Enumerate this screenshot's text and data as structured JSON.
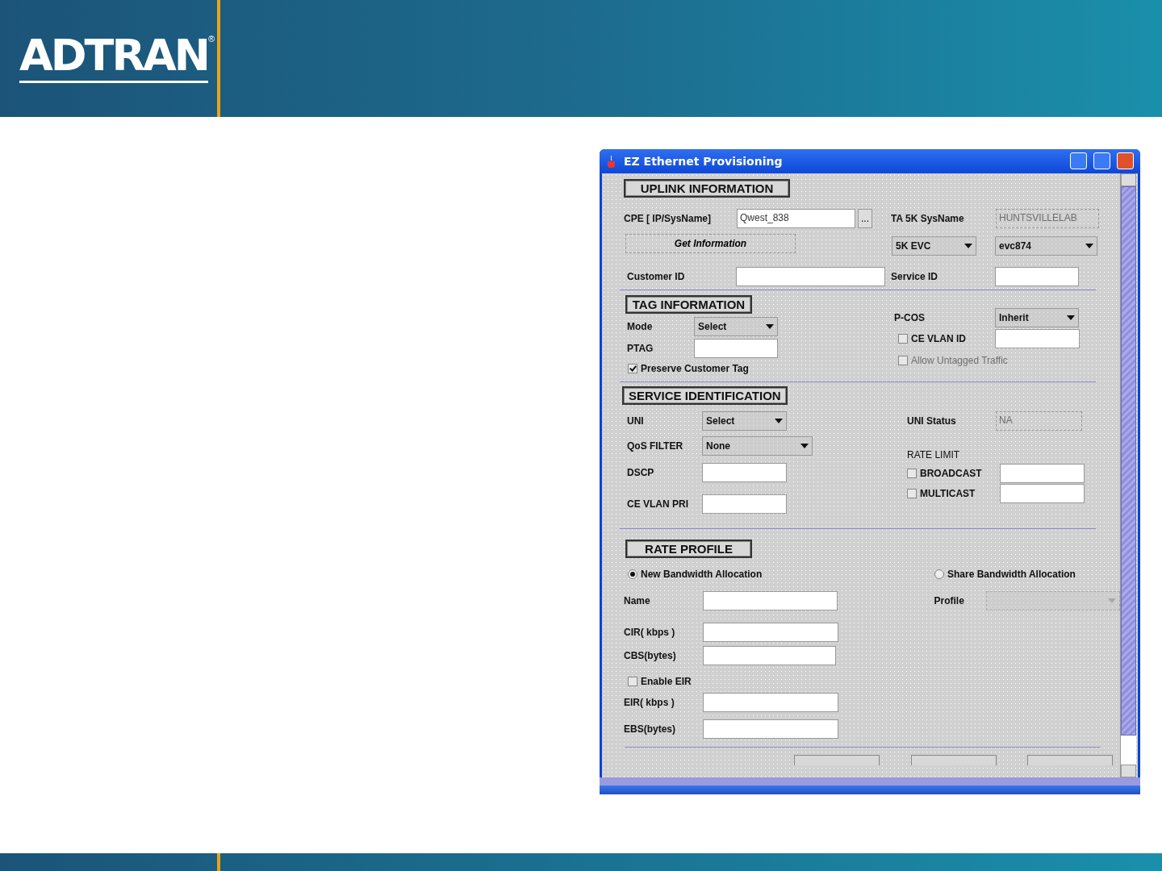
{
  "slide": {
    "logo": "ADTRAN",
    "logo_mark": "®"
  },
  "window": {
    "title": "EZ Ethernet Provisioning"
  },
  "uplink": {
    "heading": "UPLINK INFORMATION",
    "cpe_label": "CPE [ IP/SysName]",
    "cpe_value": "Qwest_838",
    "browse_button": "...",
    "sysname_label": "TA 5K SysName",
    "sysname": {
      "value": "HUNTSVILLELAB",
      "disabled": true
    },
    "get_info_button": "Get Information",
    "evc_type": "5K EVC",
    "evc": "evc874",
    "customer_id_label": "Customer ID",
    "service_id_label": "Service ID"
  },
  "tag": {
    "heading": "TAG INFORMATION",
    "mode_label": "Mode",
    "mode": "Select",
    "ptag_label": "PTAG",
    "preserve": {
      "label": "Preserve Customer Tag",
      "checked": true
    },
    "pcos_label": "P-COS",
    "pcos": "Inherit",
    "ce_vlan_id": {
      "label": "CE VLAN ID",
      "checked": false
    },
    "allow_untagged": {
      "label": "Allow Untagged Traffic",
      "checked": false,
      "disabled": true
    }
  },
  "service": {
    "heading": "SERVICE IDENTIFICATION",
    "uni_label": "UNI",
    "uni": "Select",
    "qos_label": "QoS FILTER",
    "qos": "None",
    "dscp_label": "DSCP",
    "ce_vlan_pri_label": "CE VLAN PRI",
    "uni_status_label": "UNI Status",
    "uni_status": {
      "value": "NA",
      "disabled": true
    },
    "rate_limit_label": "RATE LIMIT",
    "broadcast": {
      "label": "BROADCAST",
      "checked": false
    },
    "multicast": {
      "label": "MULTICAST",
      "checked": false
    }
  },
  "rate_profile": {
    "heading": "RATE PROFILE",
    "allocation": [
      {
        "label": "New Bandwidth Allocation",
        "selected": true
      },
      {
        "label": "Share Bandwidth Allocation",
        "selected": false
      }
    ],
    "name_label": "Name",
    "cir_label": "CIR( kbps )",
    "cbs_label": "CBS(bytes)",
    "enable_eir": {
      "label": "Enable EIR",
      "checked": false
    },
    "eir_label": "EIR( kbps )",
    "ebs_label": "EBS(bytes)",
    "profile_label": "Profile",
    "profile": {
      "disabled": true
    }
  }
}
